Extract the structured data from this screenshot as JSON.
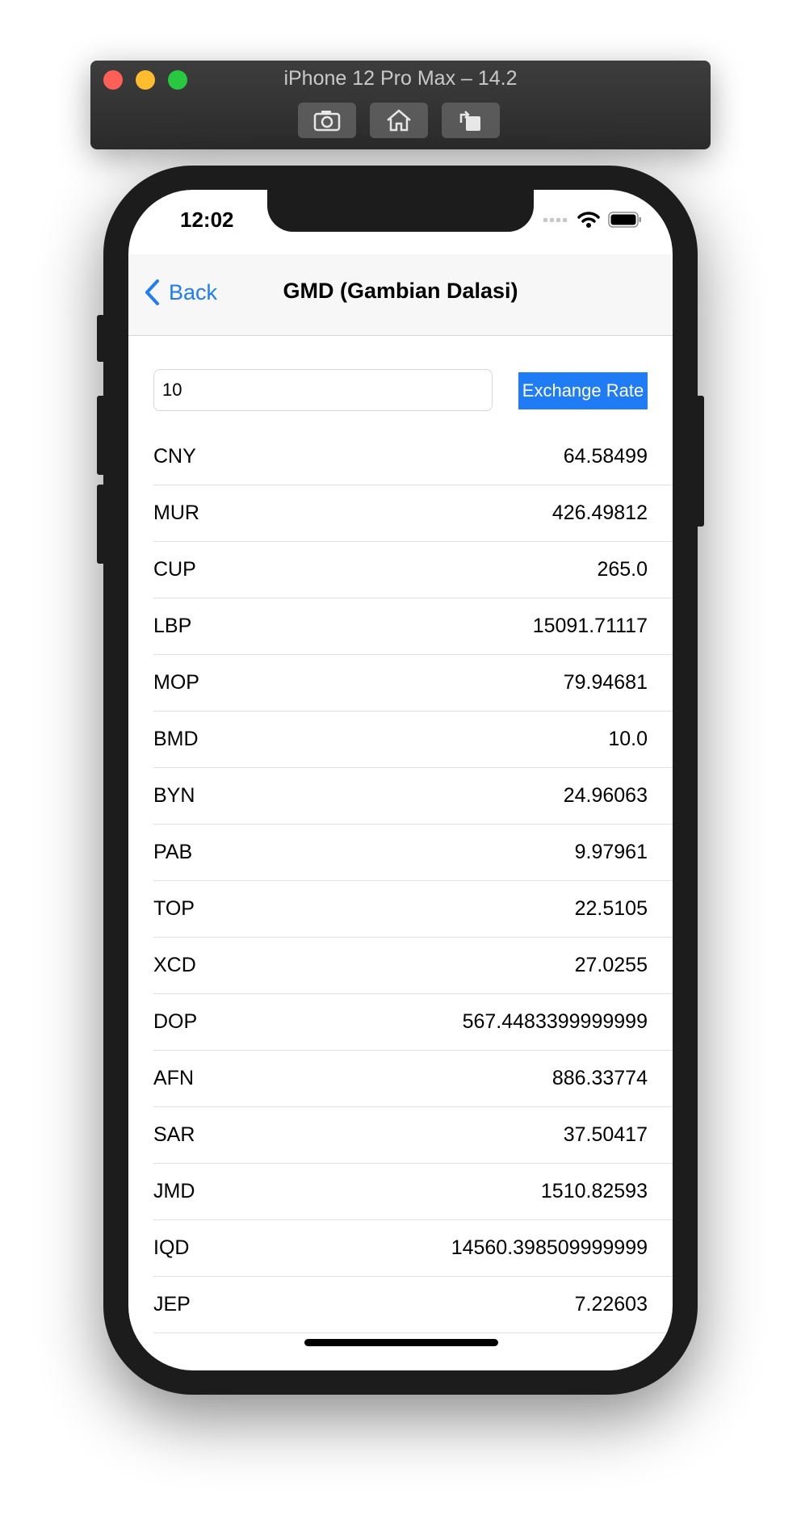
{
  "simulator": {
    "title": "iPhone 12 Pro Max – 14.2",
    "buttons": [
      "screenshot-icon",
      "home-icon",
      "rotate-icon"
    ]
  },
  "status_bar": {
    "time": "12:02"
  },
  "navbar": {
    "back_label": "Back",
    "title": "GMD (Gambian Dalasi)"
  },
  "converter": {
    "amount": "10",
    "button_label": "Exchange Rate"
  },
  "colors": {
    "accent": "#1f7cf4"
  },
  "rates": [
    {
      "code": "CNY",
      "value": "64.58499"
    },
    {
      "code": "MUR",
      "value": "426.49812"
    },
    {
      "code": "CUP",
      "value": "265.0"
    },
    {
      "code": "LBP",
      "value": "15091.71117"
    },
    {
      "code": "MOP",
      "value": "79.94681"
    },
    {
      "code": "BMD",
      "value": "10.0"
    },
    {
      "code": "BYN",
      "value": "24.96063"
    },
    {
      "code": "PAB",
      "value": "9.97961"
    },
    {
      "code": "TOP",
      "value": "22.5105"
    },
    {
      "code": "XCD",
      "value": "27.0255"
    },
    {
      "code": "DOP",
      "value": "567.4483399999999"
    },
    {
      "code": "AFN",
      "value": "886.33774"
    },
    {
      "code": "SAR",
      "value": "37.50417"
    },
    {
      "code": "JMD",
      "value": "1510.82593"
    },
    {
      "code": "IQD",
      "value": "14560.398509999999"
    },
    {
      "code": "JEP",
      "value": "7.22603"
    }
  ]
}
